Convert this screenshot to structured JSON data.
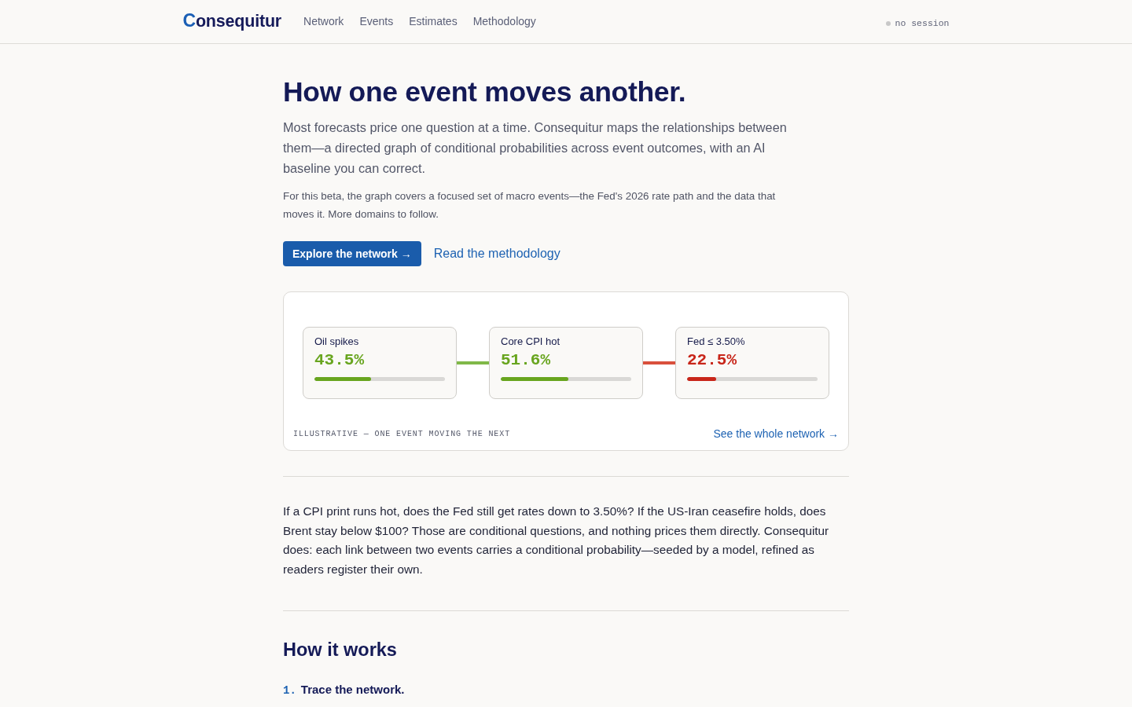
{
  "header": {
    "logo": "Consequitur",
    "nav": [
      {
        "label": "Network"
      },
      {
        "label": "Events"
      },
      {
        "label": "Estimates"
      },
      {
        "label": "Methodology"
      }
    ],
    "session": "no session"
  },
  "hero": {
    "title": "How one event moves another.",
    "lede": "Most forecasts price one question at a time. Consequitur maps the relationships between them—a directed graph of conditional probabilities across event outcomes, with an AI baseline you can correct.",
    "note": "For this beta, the graph covers a focused set of macro events—the Fed's 2026 rate path and the data that moves it. More domains to follow.",
    "primary_action": "Explore the network →",
    "secondary_action": "Read the methodology"
  },
  "illustration": {
    "nodes": [
      {
        "label": "Oil spikes",
        "value": "43.5%",
        "level": 0.435,
        "color": "#68a51f"
      },
      {
        "label": "Core CPI hot",
        "value": "51.6%",
        "level": 0.516,
        "color": "#68a51f"
      },
      {
        "label": "Fed ≤ 3.50%",
        "value": "22.5%",
        "level": 0.225,
        "color": "#c8261a"
      }
    ],
    "connectors": [
      {
        "color": "#80b848"
      },
      {
        "color": "#d9503c"
      }
    ],
    "caption": "ILLUSTRATIVE — ONE EVENT MOVING THE NEXT",
    "link": "See the whole network →"
  },
  "intro": "If a CPI print runs hot, does the Fed still get rates down to 3.50%? If the US-Iran ceasefire holds, does Brent stay below $100? Those are conditional questions, and nothing prices them directly. Consequitur does: each link between two events carries a conditional probability—seeded by a model, refined as readers register their own.",
  "how_it_works": {
    "title": "How it works",
    "steps": [
      {
        "number": "1.",
        "title": "Trace the network."
      }
    ]
  }
}
